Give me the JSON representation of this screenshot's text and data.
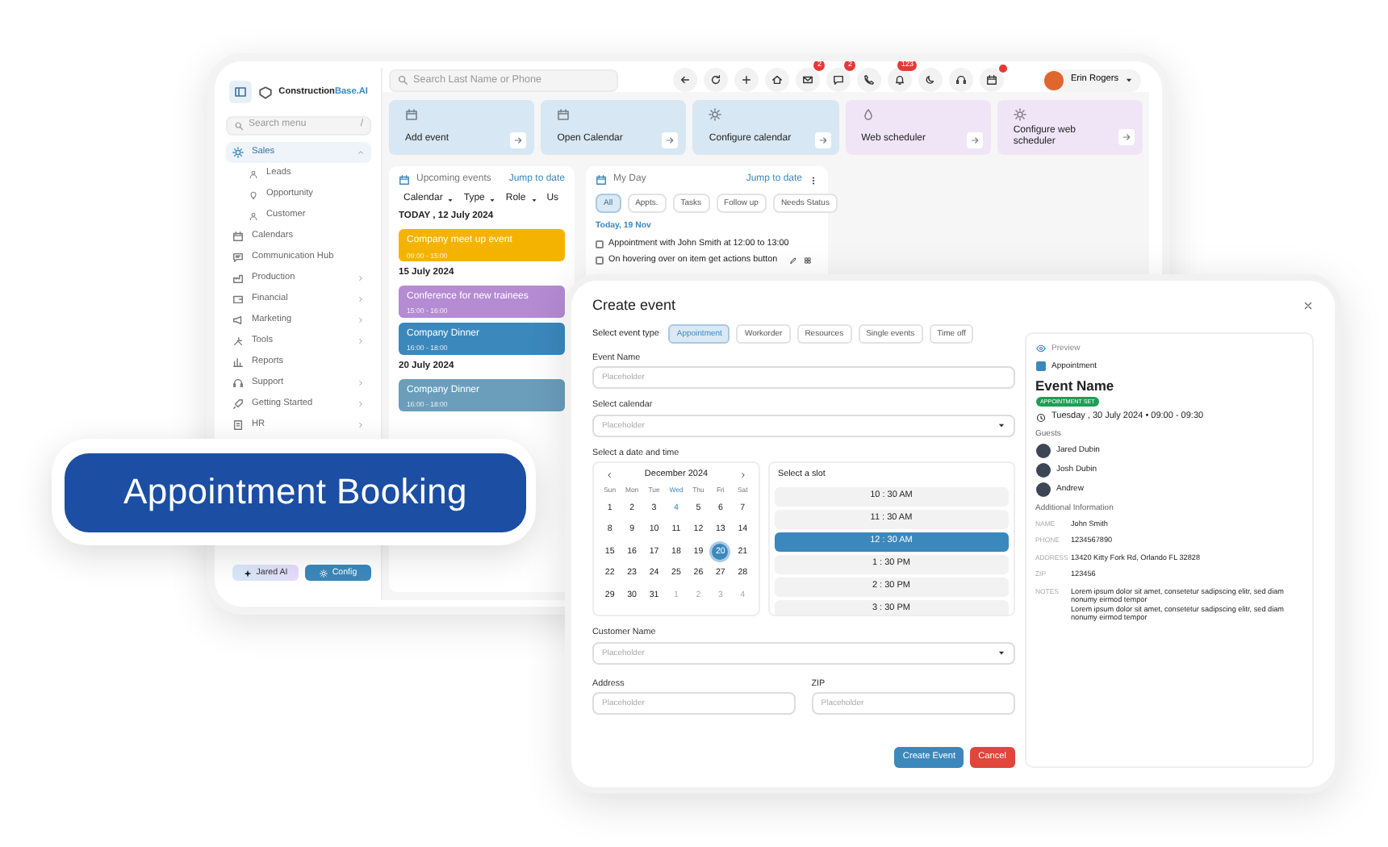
{
  "app": {
    "brand_main": "Construction",
    "brand_accent": "Base.AI",
    "search": {
      "placeholder": "Search Last Name or Phone"
    },
    "toolbar": [
      {
        "dot": false
      },
      {
        "dot": false
      },
      {
        "dot": false
      },
      {
        "dot": false
      },
      {
        "dot": false,
        "badge": "2"
      },
      {
        "dot": false,
        "badge": "2"
      },
      {
        "dot": false
      },
      {
        "dot": false,
        "badge": "123"
      },
      {
        "dot": false
      },
      {
        "dot": false
      },
      {
        "dot": true
      }
    ],
    "user": {
      "name": "Erin Rogers"
    },
    "sidebar": {
      "search": {
        "placeholder": "Search menu",
        "shortcut": "/"
      },
      "items": [
        {
          "label": "Sales",
          "selected": true,
          "expanded": true,
          "children": [
            {
              "label": "Leads"
            },
            {
              "label": "Opportunity"
            },
            {
              "label": "Customer"
            }
          ]
        },
        {
          "label": "Calendars",
          "selected": false
        },
        {
          "label": "Communication Hub",
          "selected": false
        },
        {
          "label": "Production",
          "selected": false,
          "expanded": false
        },
        {
          "label": "Financial",
          "selected": false,
          "expanded": false
        },
        {
          "label": "Marketing",
          "selected": false,
          "expanded": false
        },
        {
          "label": "Tools",
          "selected": false,
          "expanded": false
        },
        {
          "label": "Reports",
          "selected": false
        },
        {
          "label": "Support",
          "selected": false,
          "expanded": false
        },
        {
          "label": "Getting Started",
          "selected": false,
          "expanded": false
        },
        {
          "label": "HR",
          "selected": false,
          "expanded": false
        }
      ]
    },
    "footer_buttons": [
      {
        "label": "Jared AI",
        "kind": "ai"
      },
      {
        "label": "Config",
        "kind": "config"
      }
    ],
    "quick_actions": [
      {
        "label": "Add event",
        "color": "#d7e7f3"
      },
      {
        "label": "Open Calendar",
        "color": "#d7e7f3"
      },
      {
        "label": "Configure calendar",
        "color": "#d7e7f3"
      },
      {
        "label": "Web scheduler",
        "color": "#efe5f7"
      },
      {
        "label": "Configure web scheduler",
        "color": "#efe5f7"
      }
    ],
    "upcoming": {
      "title": "Upcoming events",
      "jump": "Jump to date",
      "filters": [
        {
          "label": "Calendar",
          "dropdown": true
        },
        {
          "label": "Type",
          "dropdown": true
        },
        {
          "label": "Role",
          "dropdown": true
        },
        {
          "label": "Us",
          "dropdown": false
        }
      ],
      "groups": [
        {
          "date": "TODAY , 12 July 2024",
          "events": [
            {
              "title": "Company meet up event",
              "time": "09:00 - 15:00",
              "color": "#f5b301"
            }
          ]
        },
        {
          "date": "15 July 2024",
          "events": [
            {
              "title": "Conference for new trainees",
              "time": "15:00 - 16:00",
              "color": "#b58bd4"
            },
            {
              "title": "Company Dinner",
              "time": "16:00 - 18:00",
              "color": "#3b88bd"
            }
          ]
        },
        {
          "date": "20 July 2024",
          "events": [
            {
              "title": "Company Dinner",
              "time": "16:00 - 18:00",
              "color": "#6a9ebb"
            }
          ]
        }
      ]
    },
    "my_day": {
      "title": "My Day",
      "jump": "Jump to date",
      "chips": [
        {
          "label": "All",
          "selected": true
        },
        {
          "label": "Appts.",
          "selected": false
        },
        {
          "label": "Tasks",
          "selected": false
        },
        {
          "label": "Follow up",
          "selected": false
        },
        {
          "label": "Needs Status",
          "selected": false
        }
      ],
      "date": "Today, 19 Nov",
      "tasks": [
        {
          "text": "Appointment with John Smith at 12:00 to 13:00",
          "checked": false,
          "kind": "plain"
        },
        {
          "text": "On hovering over on item get actions button",
          "checked": false,
          "kind": "actions"
        }
      ]
    }
  },
  "modal": {
    "title": "Create event",
    "event_type_label": "Select event type",
    "event_types": [
      {
        "label": "Appointment",
        "selected": true
      },
      {
        "label": "Workorder",
        "selected": false
      },
      {
        "label": "Resources",
        "selected": false
      },
      {
        "label": "Single events",
        "selected": false
      },
      {
        "label": "Time off",
        "selected": false
      }
    ],
    "event_name": {
      "label": "Event Name",
      "placeholder": "Placeholder"
    },
    "calendar_select": {
      "label": "Select calendar",
      "placeholder": "Placeholder"
    },
    "date_time_label": "Select a date and time",
    "date_picker": {
      "month": "December 2024",
      "weekdays": [
        {
          "label": "Sun",
          "current": false
        },
        {
          "label": "Mon",
          "current": false
        },
        {
          "label": "Tue",
          "current": false
        },
        {
          "label": "Wed",
          "current": true
        },
        {
          "label": "Thu",
          "current": false
        },
        {
          "label": "Fri",
          "current": false
        },
        {
          "label": "Sat",
          "current": false
        }
      ],
      "days": [
        {
          "label": "1",
          "kind": "day",
          "selected": false
        },
        {
          "label": "2",
          "kind": "day",
          "selected": false
        },
        {
          "label": "3",
          "kind": "day",
          "selected": false
        },
        {
          "label": "4",
          "kind": "today",
          "selected": false
        },
        {
          "label": "5",
          "kind": "day",
          "selected": false
        },
        {
          "label": "6",
          "kind": "day",
          "selected": false
        },
        {
          "label": "7",
          "kind": "day",
          "selected": false
        },
        {
          "label": "8",
          "kind": "day",
          "selected": false
        },
        {
          "label": "9",
          "kind": "day",
          "selected": false
        },
        {
          "label": "10",
          "kind": "day",
          "selected": false
        },
        {
          "label": "11",
          "kind": "day",
          "selected": false
        },
        {
          "label": "12",
          "kind": "day",
          "selected": false
        },
        {
          "label": "13",
          "kind": "day",
          "selected": false
        },
        {
          "label": "14",
          "kind": "day",
          "selected": false
        },
        {
          "label": "15",
          "kind": "day",
          "selected": false
        },
        {
          "label": "16",
          "kind": "day",
          "selected": false
        },
        {
          "label": "17",
          "kind": "day",
          "selected": false
        },
        {
          "label": "18",
          "kind": "day",
          "selected": false
        },
        {
          "label": "19",
          "kind": "day",
          "selected": false
        },
        {
          "label": "20",
          "kind": "day",
          "selected": true
        },
        {
          "label": "21",
          "kind": "day",
          "selected": false
        },
        {
          "label": "22",
          "kind": "day",
          "selected": false
        },
        {
          "label": "23",
          "kind": "day",
          "selected": false
        },
        {
          "label": "24",
          "kind": "day",
          "selected": false
        },
        {
          "label": "25",
          "kind": "day",
          "selected": false
        },
        {
          "label": "26",
          "kind": "day",
          "selected": false
        },
        {
          "label": "27",
          "kind": "day",
          "selected": false
        },
        {
          "label": "28",
          "kind": "day",
          "selected": false
        },
        {
          "label": "29",
          "kind": "day",
          "selected": false
        },
        {
          "label": "30",
          "kind": "day",
          "selected": false
        },
        {
          "label": "31",
          "kind": "day",
          "selected": false
        },
        {
          "label": "1",
          "kind": "outside",
          "selected": false
        },
        {
          "label": "2",
          "kind": "outside",
          "selected": false
        },
        {
          "label": "3",
          "kind": "outside",
          "selected": false
        },
        {
          "label": "4",
          "kind": "outside",
          "selected": false
        }
      ]
    },
    "slot_label": "Select a slot",
    "slots": [
      {
        "label": "10 : 30 AM",
        "selected": false
      },
      {
        "label": "11 : 30 AM",
        "selected": false
      },
      {
        "label": "12 : 30 AM",
        "selected": true
      },
      {
        "label": "1 : 30 PM",
        "selected": false
      },
      {
        "label": "2 : 30 PM",
        "selected": false
      },
      {
        "label": "3 : 30 PM",
        "selected": false
      }
    ],
    "customer": {
      "label": "Customer Name",
      "placeholder": "Placeholder"
    },
    "address": {
      "label": "Address",
      "placeholder": "Placeholder"
    },
    "zip": {
      "label": "ZIP",
      "placeholder": "Placeholder"
    },
    "buttons": [
      {
        "label": "Create Event",
        "kind": "primary"
      },
      {
        "label": "Cancel",
        "kind": "danger"
      }
    ],
    "preview": {
      "label": "Preview",
      "type": {
        "label": "Appointment",
        "color": "#3b88bd"
      },
      "event_name": "Event Name",
      "status": "APPOINTMENT SET",
      "when": "Tuesday , 30 July 2024 • 09:00 - 09:30",
      "guests_label": "Guests",
      "guests": [
        "Jared Dubin",
        "Josh Dubin",
        "Andrew"
      ],
      "info_label": "Additional Information",
      "info": [
        {
          "key": "NAME",
          "value": [
            "John Smith"
          ]
        },
        {
          "key": "PHONE",
          "value": [
            "1234567890"
          ]
        },
        {
          "key": "ADDRESS",
          "value": [
            "13420 Kitty Fork Rd, Orlando FL 32828"
          ]
        },
        {
          "key": "ZIP",
          "value": [
            "123456"
          ]
        },
        {
          "key": "NOTES",
          "value": [
            "Lorem ipsum dolor sit amet, consetetur sadipscing elitr, sed diam nonumy eirmod tempor",
            "Lorem ipsum dolor sit amet, consetetur sadipscing elitr, sed diam nonumy eirmod tempor"
          ]
        }
      ]
    }
  },
  "banner": {
    "text": "Appointment Booking"
  }
}
